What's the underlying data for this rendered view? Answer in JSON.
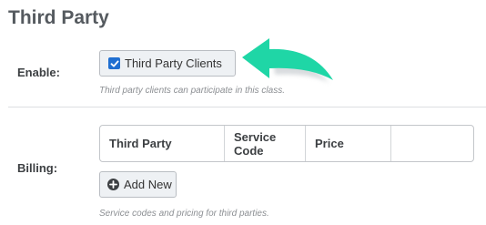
{
  "section": {
    "title": "Third Party"
  },
  "enable": {
    "label": "Enable:",
    "checkbox_label": "Third Party Clients",
    "checked": true,
    "help": "Third party clients can participate in this class."
  },
  "billing": {
    "label": "Billing:",
    "table": {
      "columns": [
        "Third Party",
        "Service Code",
        "Price",
        ""
      ]
    },
    "add_button_label": "Add New",
    "help": "Service codes and pricing for third parties."
  },
  "colors": {
    "checkbox_accent": "#1f6fd1",
    "arrow": "#1fd6a6"
  }
}
